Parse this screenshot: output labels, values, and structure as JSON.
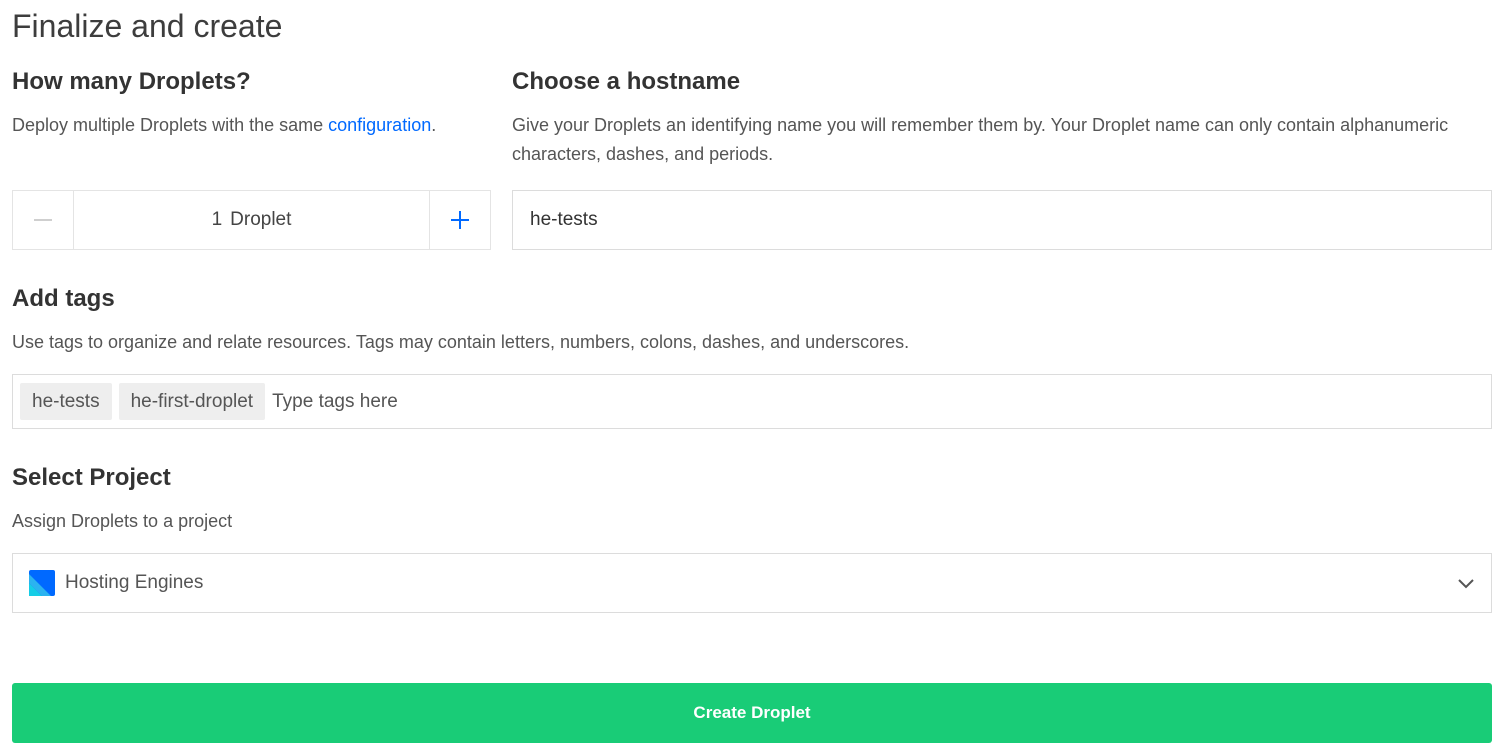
{
  "page": {
    "title": "Finalize and create"
  },
  "droplets": {
    "title": "How many Droplets?",
    "desc_prefix": "Deploy multiple Droplets with the same ",
    "desc_link": "configuration",
    "desc_suffix": ".",
    "count": "1",
    "unit": "Droplet",
    "decrement_icon": "minus-icon",
    "increment_icon": "plus-icon"
  },
  "hostname": {
    "title": "Choose a hostname",
    "desc": "Give your Droplets an identifying name you will remember them by. Your Droplet name can only contain alphanumeric characters, dashes, and periods.",
    "value": "he-tests"
  },
  "tags": {
    "title": "Add tags",
    "desc": "Use tags to organize and relate resources. Tags may contain letters, numbers, colons, dashes, and underscores.",
    "items": [
      "he-tests",
      "he-first-droplet"
    ],
    "placeholder": "Type tags here"
  },
  "project": {
    "title": "Select Project",
    "desc": "Assign Droplets to a project",
    "selected": "Hosting Engines",
    "icon": "project-icon",
    "dropdown_icon": "chevron-down-icon"
  },
  "actions": {
    "create_label": "Create Droplet"
  },
  "colors": {
    "accent": "#0069ff",
    "create_button": "#19cc77",
    "project_icon_primary": "#0069ff",
    "project_icon_secondary": "#15cde6"
  }
}
